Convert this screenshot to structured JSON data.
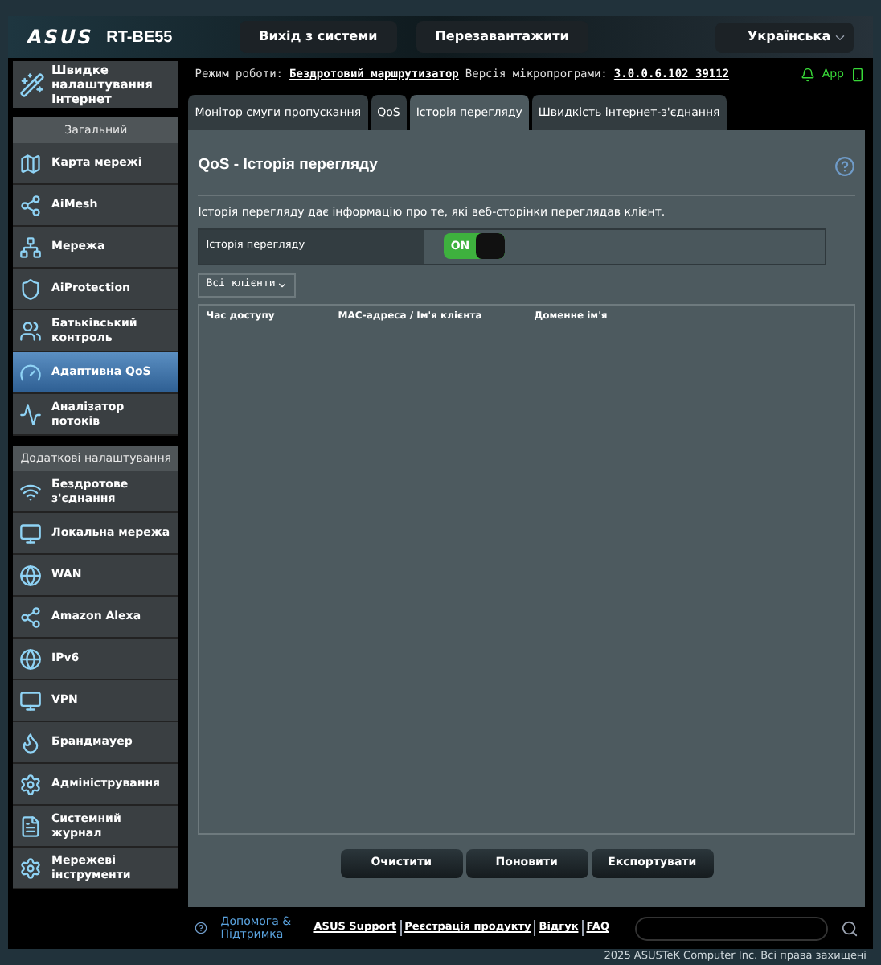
{
  "header": {
    "logo": "ASUS",
    "model": "RT-BE55",
    "buttons": [
      "Вихід з системи",
      "Перезавантажити"
    ],
    "language": "Українська"
  },
  "status": {
    "mode_label": "Режим роботи:",
    "mode": "Бездротовий маршрутизатор",
    "firmware_label": "Версія мікропрограми:",
    "firmware": "3.0.0.6.102_39112",
    "app": "App"
  },
  "quick_setup": "Швидке налаштування Інтернет",
  "sidebar": [
    {
      "title": "Загальний",
      "items": [
        {
          "label": "Карта мережі",
          "selected": false
        },
        {
          "label": "AiMesh",
          "selected": false
        },
        {
          "label": "Мережа",
          "selected": false
        },
        {
          "label": "AiProtection",
          "selected": false
        },
        {
          "label": "Батьківський контроль",
          "selected": false
        },
        {
          "label": "Адаптивна QoS",
          "selected": true
        },
        {
          "label": "Аналізатор потоків",
          "selected": false
        }
      ]
    },
    {
      "title": "Додаткові налаштування",
      "items": [
        {
          "label": "Бездротове з'єднання",
          "selected": false
        },
        {
          "label": "Локальна мережа",
          "selected": false
        },
        {
          "label": "WAN",
          "selected": false
        },
        {
          "label": "Amazon Alexa",
          "selected": false
        },
        {
          "label": "IPv6",
          "selected": false
        },
        {
          "label": "VPN",
          "selected": false
        },
        {
          "label": "Брандмауер",
          "selected": false
        },
        {
          "label": "Адміністрування",
          "selected": false
        },
        {
          "label": "Системний журнал",
          "selected": false
        },
        {
          "label": "Мережеві інструменти",
          "selected": false
        }
      ]
    }
  ],
  "tabs": [
    {
      "label": "Монітор смуги пропускання",
      "selected": false
    },
    {
      "label": "QoS",
      "selected": false
    },
    {
      "label": "Історія перегляду",
      "selected": true
    },
    {
      "label": "Швидкість інтернет-з'єднання",
      "selected": false
    }
  ],
  "panel": {
    "title": "QoS - Історія перегляду",
    "description": "Історія перегляду дає інформацію про те, які веб-сторінки переглядав клієнт.",
    "setting": {
      "label": "Історія перегляду",
      "on": true,
      "on_text": "ON"
    },
    "client_filter": "Всі клієнти",
    "table": {
      "columns": [
        "Час доступу",
        "MAC-адреса / Ім'я клієнта",
        "Доменне ім'я"
      ]
    },
    "buttons": [
      "Очистити",
      "Поновити",
      "Експортувати"
    ]
  },
  "footer": {
    "help": "Допомога & Підтримка",
    "links": [
      "ASUS Support",
      "Реєстрація продукту",
      "Відгук",
      "FAQ"
    ]
  },
  "copyright": "2025 ASUSTeK Computer Inc. Всі права захищені"
}
